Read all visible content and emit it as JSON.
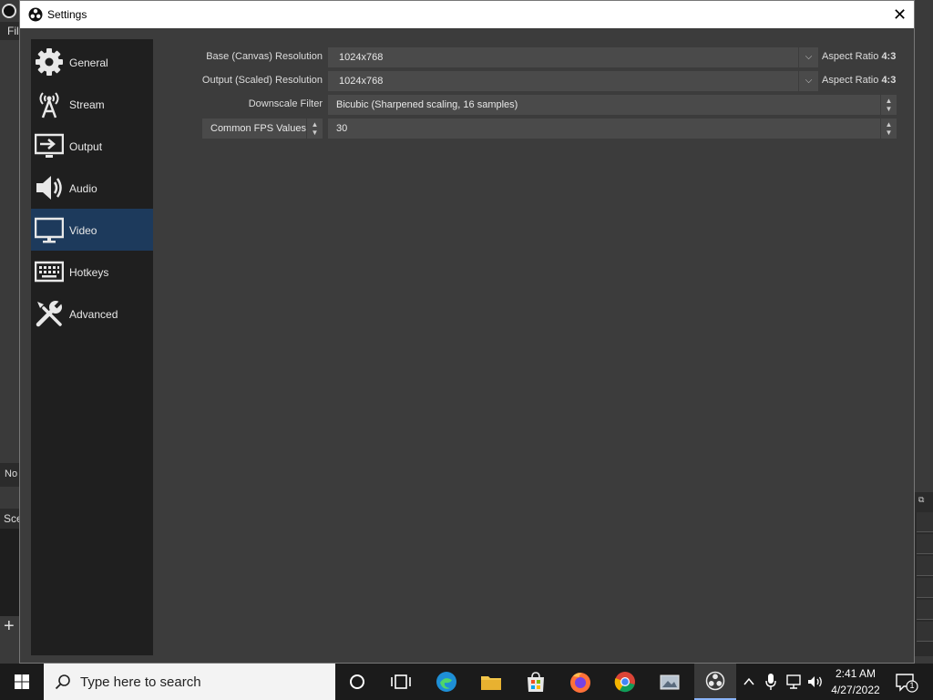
{
  "background_window": {
    "menu_partial": "Fil",
    "status_partial": "No",
    "scenes_partial": "Sce"
  },
  "dialog": {
    "title": "Settings",
    "close_glyph": "✕"
  },
  "sidebar": {
    "items": [
      {
        "label": "General",
        "icon": "gear-icon"
      },
      {
        "label": "Stream",
        "icon": "broadcast-icon"
      },
      {
        "label": "Output",
        "icon": "output-icon"
      },
      {
        "label": "Audio",
        "icon": "speaker-icon"
      },
      {
        "label": "Video",
        "icon": "monitor-icon",
        "active": true
      },
      {
        "label": "Hotkeys",
        "icon": "keyboard-icon"
      },
      {
        "label": "Advanced",
        "icon": "tools-icon"
      }
    ]
  },
  "video": {
    "base_resolution": {
      "label": "Base (Canvas) Resolution",
      "value": "1024x768",
      "aspect_label": "Aspect Ratio",
      "aspect_value": "4:3"
    },
    "output_resolution": {
      "label": "Output (Scaled) Resolution",
      "value": "1024x768",
      "aspect_label": "Aspect Ratio",
      "aspect_value": "4:3"
    },
    "downscale_filter": {
      "label": "Downscale Filter",
      "value": "Bicubic (Sharpened scaling, 16 samples)"
    },
    "fps": {
      "type_label": "Common FPS Values",
      "value": "30"
    }
  },
  "taskbar": {
    "search_placeholder": "Type here to search",
    "time": "2:41 AM",
    "date": "4/27/2022",
    "notification_count": "1"
  },
  "colors": {
    "active_nav": "#1d3a5c",
    "dialog_bg": "#3c3c3c",
    "sidebar_bg": "#1f1f1f"
  }
}
